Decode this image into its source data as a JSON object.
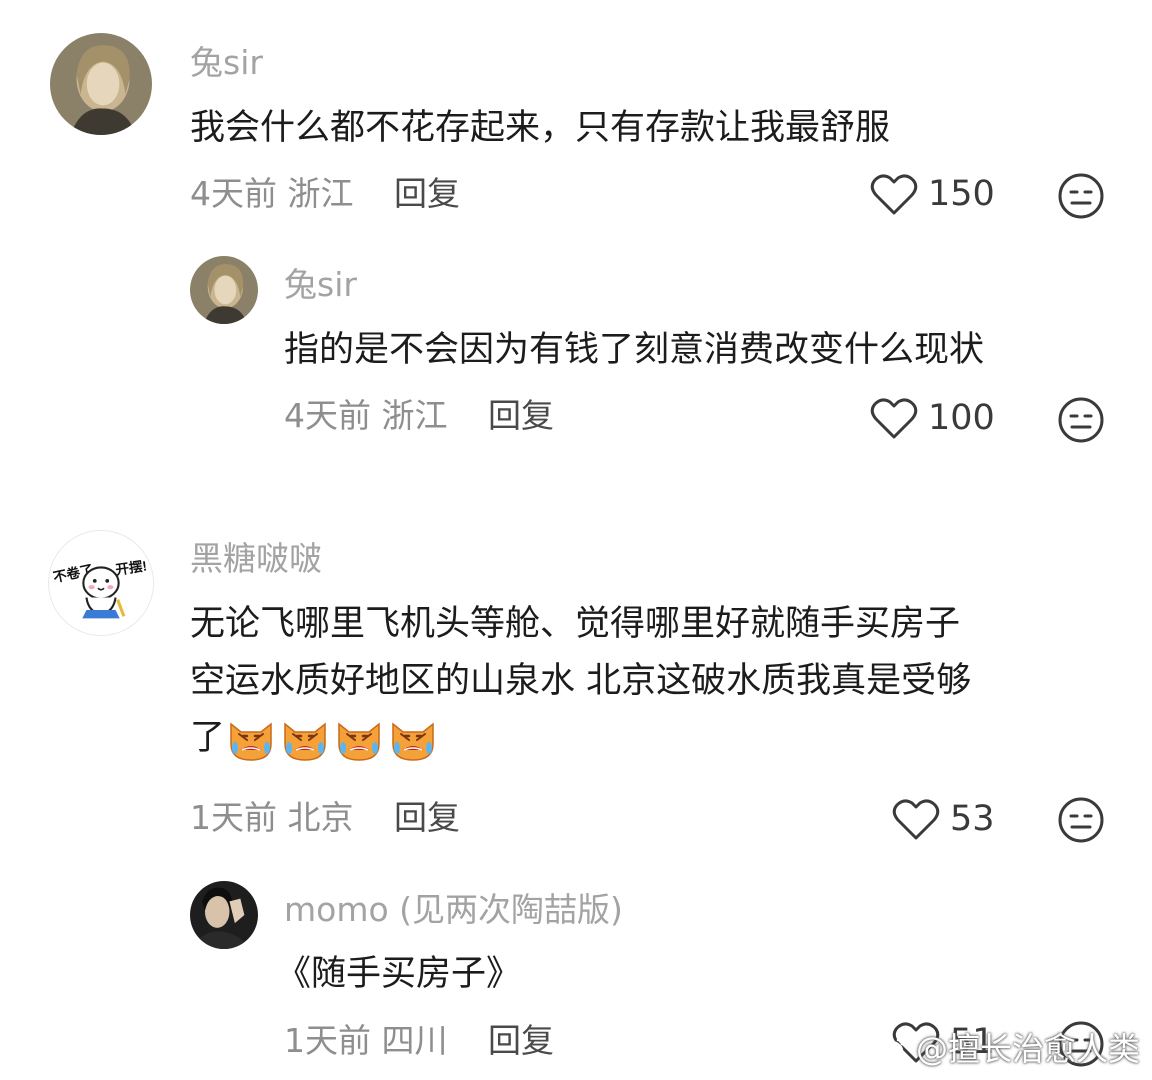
{
  "comments": [
    {
      "username": "兔sir",
      "text_lines": [
        "我会什么都不花存起来，只有存款让我最舒服"
      ],
      "time": "4天前",
      "location": "浙江",
      "reply_label": "回复",
      "likes": "150",
      "reply": {
        "username": "兔sir",
        "text_lines": [
          "指的是不会因为有钱了刻意消费改变什么现状"
        ],
        "time": "4天前",
        "location": "浙江",
        "reply_label": "回复",
        "likes": "100"
      }
    },
    {
      "username": "黑糖啵啵",
      "avatar_text_left": "不卷了",
      "avatar_text_right": "开摆!",
      "text_lines": [
        "无论飞哪里飞机头等舱、觉得哪里好就随手买房子",
        "空运水质好地区的山泉水 北京这破水质我真是受够",
        "了"
      ],
      "emoji": "crying-cat-emoji",
      "emoji_count": 4,
      "time": "1天前",
      "location": "北京",
      "reply_label": "回复",
      "likes": "53",
      "reply": {
        "username": "momo",
        "username_tag": "(见两次陶喆版)",
        "text_lines": [
          "《随手买房子》"
        ],
        "time": "1天前",
        "location": "四川",
        "reply_label": "回复",
        "likes": "51"
      }
    }
  ],
  "watermark": {
    "text": "@擅长治愈人类",
    "icon": "weibo-icon"
  },
  "colors": {
    "username": "#a3a3a3",
    "meta": "#8e8e8e",
    "text": "#1c1c1c",
    "cat_orange": "#f4a13a"
  }
}
